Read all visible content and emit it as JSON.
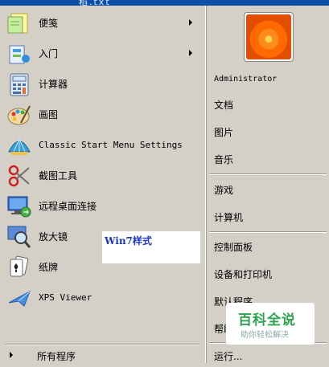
{
  "window": {
    "title_fragment": "稻.txt"
  },
  "left_menu": {
    "items": [
      {
        "label": "便笺",
        "icon": "sticky-notes-icon",
        "has_submenu": true
      },
      {
        "label": "入门",
        "icon": "getting-started-icon",
        "has_submenu": true
      },
      {
        "label": "计算器",
        "icon": "calculator-icon",
        "has_submenu": false
      },
      {
        "label": "画图",
        "icon": "paint-palette-icon",
        "has_submenu": false
      },
      {
        "label": "Classic Start Menu Settings",
        "icon": "shell-icon",
        "has_submenu": false
      },
      {
        "label": "截图工具",
        "icon": "scissors-icon",
        "has_submenu": false
      },
      {
        "label": "远程桌面连接",
        "icon": "remote-desktop-icon",
        "has_submenu": false
      },
      {
        "label": "放大镜",
        "icon": "magnifier-icon",
        "has_submenu": false
      },
      {
        "label": "纸牌",
        "icon": "cards-icon",
        "has_submenu": false
      },
      {
        "label": "XPS Viewer",
        "icon": "xps-viewer-icon",
        "has_submenu": false
      }
    ],
    "all_programs": "所有程序"
  },
  "note": {
    "text": "Win7样式"
  },
  "right_menu": {
    "user": "Administrator",
    "items": [
      "文档",
      "图片",
      "音乐",
      "游戏",
      "计算机",
      "控制面板",
      "设备和打印机",
      "默认程序",
      "帮助和支持",
      "运行..."
    ]
  },
  "watermark": {
    "title": "百科全说",
    "subtitle": "助你轻松解决"
  }
}
